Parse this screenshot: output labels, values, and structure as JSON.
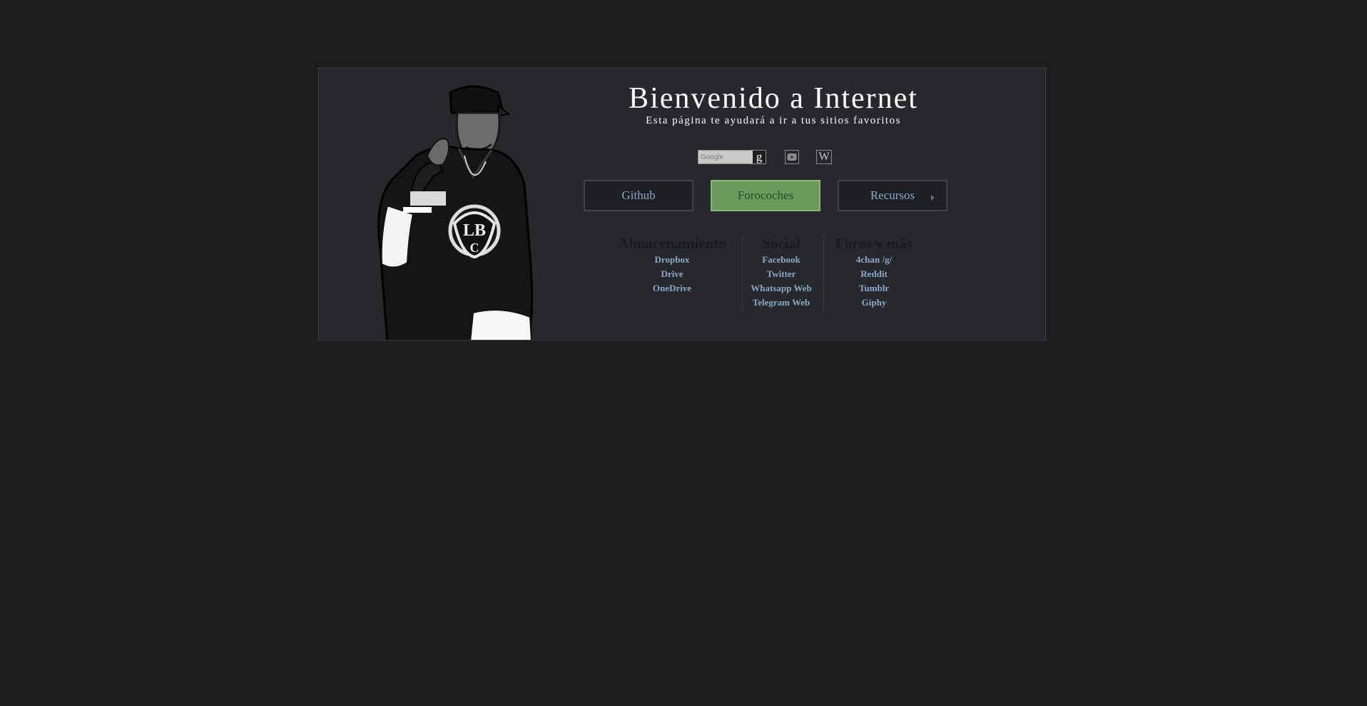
{
  "header": {
    "title": "Bienvenido a Internet",
    "subtitle": "Esta página te ayudará a ir a tus sitios favoritos"
  },
  "search": {
    "placeholder": "Google",
    "button_glyph": "g"
  },
  "shortcuts": {
    "youtube_icon": "youtube-icon",
    "wikipedia_glyph": "W"
  },
  "nav": {
    "buttons": [
      {
        "label": "Github"
      },
      {
        "label": "Forocoches",
        "active": true
      },
      {
        "label": "Recursos",
        "has_chevron": true
      }
    ]
  },
  "colors": {
    "background": "#1d1e20",
    "card": "#27282c",
    "link": "#8aa9cc",
    "active_button": "#6a9a5c"
  },
  "columns": [
    {
      "heading": "Almacenamiento",
      "links": [
        "Dropbox",
        "Drive",
        "OneDrive"
      ]
    },
    {
      "heading": "Social",
      "links": [
        "Facebook",
        "Twitter",
        "Whatsapp Web",
        "Telegram Web"
      ]
    },
    {
      "heading": "Foros y más",
      "links": [
        "4chan /g/",
        "Reddit",
        "Tumblr",
        "Giphy"
      ]
    }
  ]
}
